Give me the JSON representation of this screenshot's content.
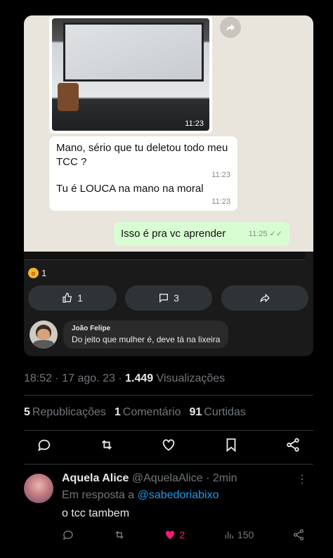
{
  "screenshot": {
    "photo_time": "11:23",
    "messages": [
      {
        "text": "Mano, sério que tu deletou todo meu TCC ?",
        "time": "11:23"
      },
      {
        "text": "Tu é LOUCA na mano na moral",
        "time": "11:23"
      }
    ],
    "outgoing": {
      "text": "Isso é pra vc aprender",
      "time": "11:25"
    },
    "reaction_count": "1",
    "buttons": {
      "like_count": "1",
      "comment_count": "3"
    },
    "comment": {
      "author": "João Felipe",
      "text": "Do jeito que mulher é, deve tá na lixeira"
    }
  },
  "post_meta": {
    "time": "18:52",
    "date": "17 ago. 23",
    "views_count": "1.449",
    "views_label": "Visualizações"
  },
  "stats": {
    "reposts_count": "5",
    "reposts_label": "Republicações",
    "comments_count": "1",
    "comments_label": "Comentário",
    "likes_count": "91",
    "likes_label": "Curtidas"
  },
  "reply": {
    "name": "Aquela Alice",
    "handle": "@AquelaAlice",
    "age": "2min",
    "replying_prefix": "Em resposta a",
    "replying_to": "@sabedoriabixo",
    "text": "o tcc tambem",
    "like_count": "2",
    "view_count": "150"
  },
  "colors": {
    "accent": "#1d9bf0",
    "like": "#f91880",
    "muted": "#71767b",
    "bg": "#000000"
  }
}
